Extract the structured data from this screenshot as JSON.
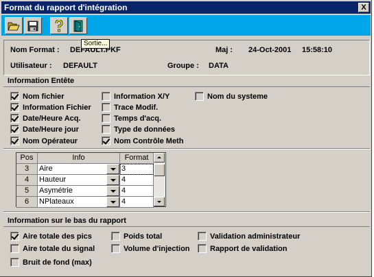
{
  "window": {
    "title": "Format du rapport d'intégration",
    "close_glyph": "X"
  },
  "toolbar": {
    "buttons": [
      {
        "icon": "open-folder-icon"
      },
      {
        "icon": "save-disk-icon"
      },
      {
        "icon": "help-question-icon"
      },
      {
        "icon": "exit-door-icon"
      }
    ],
    "tooltip": "Sortie..."
  },
  "header": {
    "nom_format_label": "Nom Format :",
    "nom_format_value": "DEFAULT.PKF",
    "maj_label": "Maj :",
    "maj_date": "24-Oct-2001",
    "maj_time": "15:58:10",
    "utilisateur_label": "Utilisateur :",
    "utilisateur_value": "DEFAULT",
    "groupe_label": "Groupe :",
    "groupe_value": "DATA"
  },
  "entete": {
    "title": "Information Entête",
    "items": [
      {
        "label": "Nom fichier",
        "checked": true
      },
      {
        "label": "Information Fichier",
        "checked": true
      },
      {
        "label": "Date/Heure Acq.",
        "checked": true
      },
      {
        "label": "Date/Heure jour",
        "checked": true
      },
      {
        "label": "Nom Opérateur",
        "checked": true
      },
      {
        "label": "Information X/Y",
        "checked": false
      },
      {
        "label": "Trace Modif.",
        "checked": false
      },
      {
        "label": "Temps d'acq.",
        "checked": false
      },
      {
        "label": "Type de données",
        "checked": false
      },
      {
        "label": "Nom Contrôle Meth",
        "checked": true
      },
      {
        "label": "Nom du systeme",
        "checked": false
      }
    ]
  },
  "grid": {
    "headers": [
      "Pos",
      "Info",
      "Format"
    ],
    "rows": [
      {
        "pos": "3",
        "info": "Aire",
        "format": "3"
      },
      {
        "pos": "4",
        "info": "Hauteur",
        "format": "4"
      },
      {
        "pos": "5",
        "info": "Asymétrie",
        "format": "4"
      },
      {
        "pos": "6",
        "info": "NPlateaux",
        "format": "4"
      }
    ]
  },
  "bas": {
    "title": "Information sur le bas du rapport",
    "items": [
      {
        "label": "Aire totale des pics",
        "checked": true
      },
      {
        "label": "Aire totale du signal",
        "checked": false
      },
      {
        "label": "Bruit de fond (max)",
        "checked": false
      },
      {
        "label": "Poids total",
        "checked": false
      },
      {
        "label": "Volume d'injection",
        "checked": false
      },
      {
        "label": "Validation administrateur",
        "checked": false
      },
      {
        "label": "Rapport de validation",
        "checked": false
      }
    ]
  }
}
